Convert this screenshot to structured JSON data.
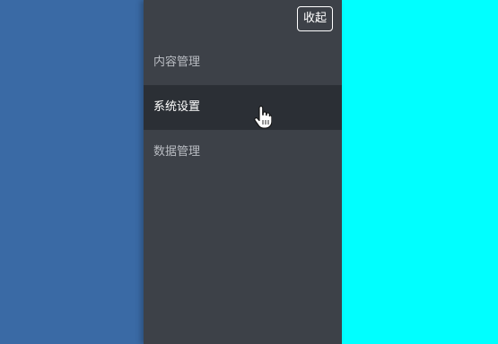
{
  "sidebar": {
    "collapse_label": "收起",
    "items": [
      {
        "label": "内容管理",
        "active": false
      },
      {
        "label": "系统设置",
        "active": true
      },
      {
        "label": "数据管理",
        "active": false
      }
    ]
  },
  "colors": {
    "left_pane": "#3a6aa5",
    "sidebar": "#3d4148",
    "active_item": "#2b2f35",
    "right_pane": "#00ffff"
  },
  "icons": {
    "cursor": "hand-pointer-icon"
  }
}
